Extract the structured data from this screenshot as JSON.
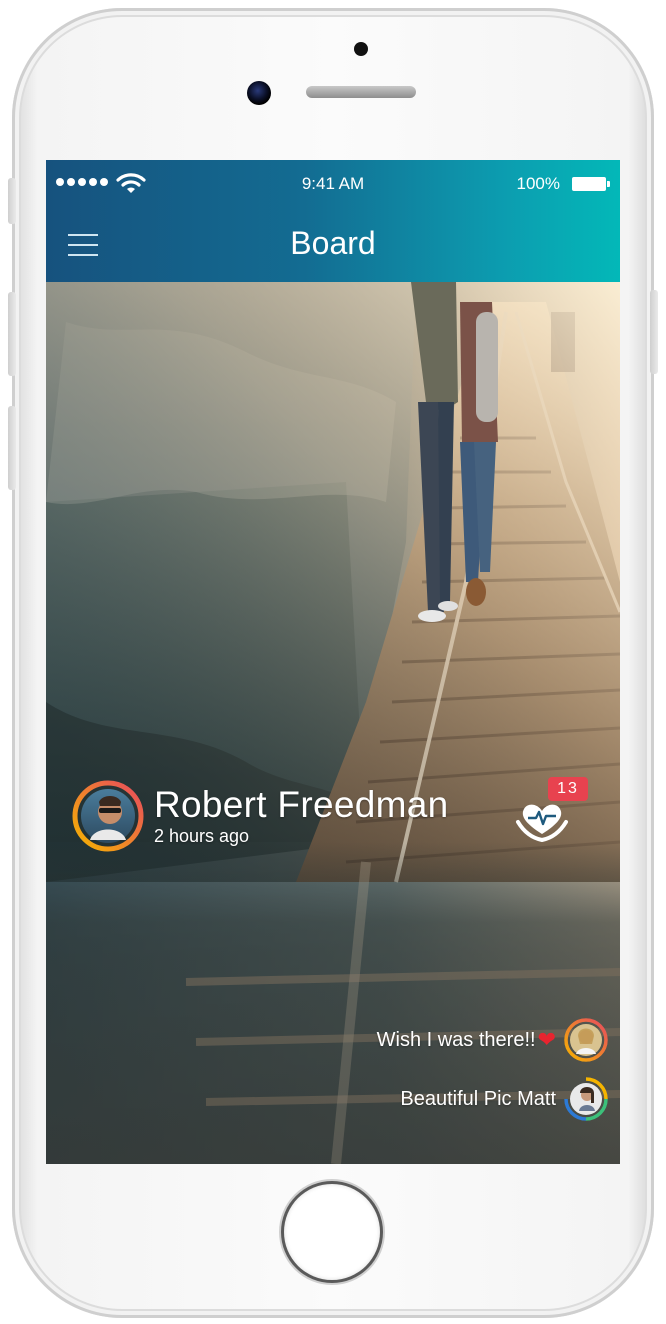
{
  "status_bar": {
    "time": "9:41 AM",
    "battery": "100%",
    "signal_icon": "signal-dots-icon",
    "wifi_icon": "wifi-icon",
    "battery_icon": "battery-icon"
  },
  "header": {
    "title": "Board",
    "menu_icon": "hamburger-menu-icon",
    "gradient": [
      "#16527e",
      "#03b8b8"
    ]
  },
  "post": {
    "author": "Robert Freedman",
    "time_ago": "2 hours ago",
    "like_count": "13",
    "like_icon": "heart-hands-icon",
    "comments": [
      {
        "text": "Wish I was there!!",
        "emoji": "heart-emoji-icon"
      },
      {
        "text": "Beautiful Pic Matt"
      }
    ]
  },
  "colors": {
    "badge": "#e8424f",
    "heart": "#e8242f",
    "ring_gradient": [
      "#f5b400",
      "#e84a5f"
    ]
  }
}
